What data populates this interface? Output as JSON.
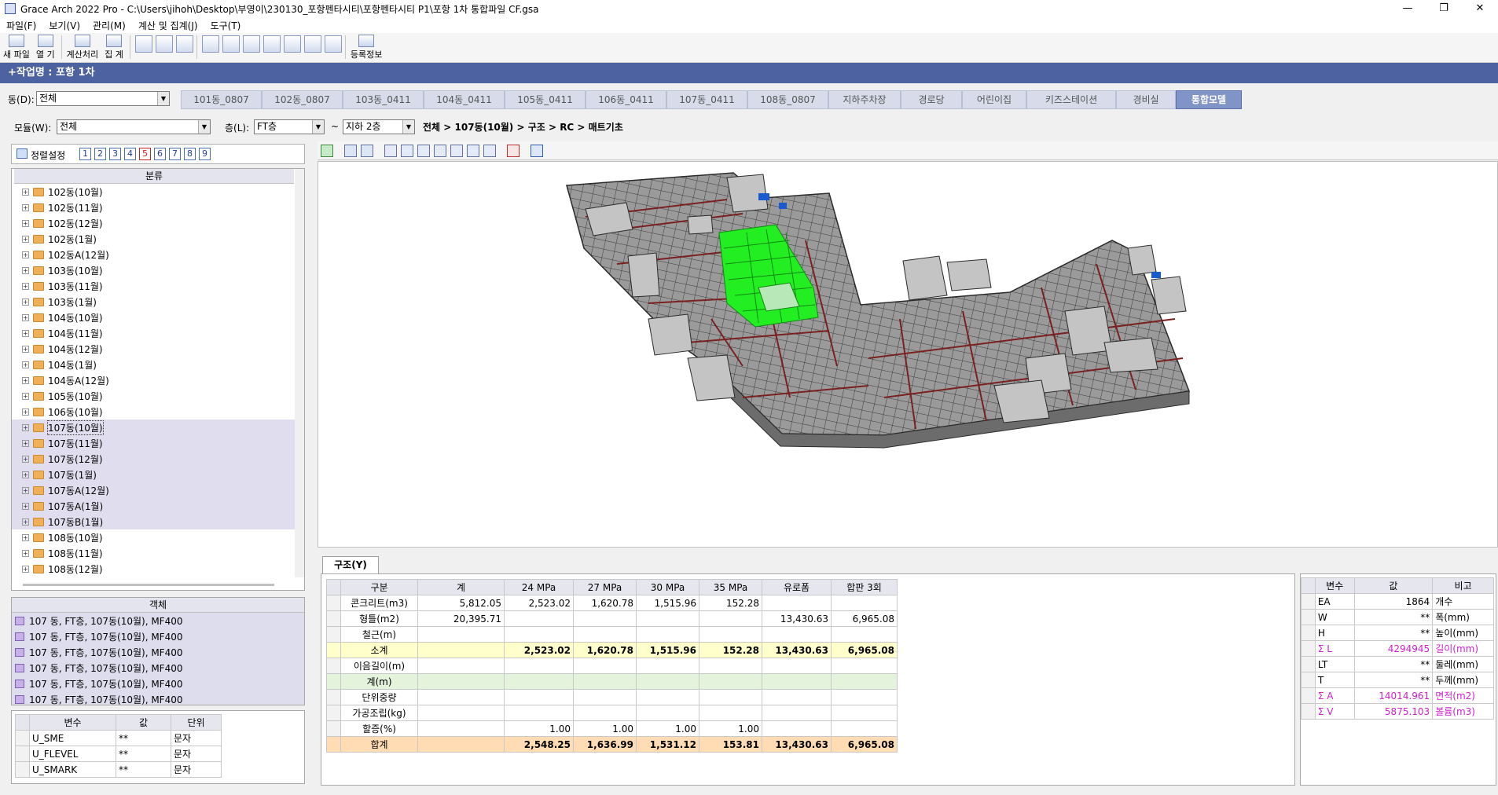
{
  "window": {
    "title": "Grace Arch 2022 Pro - C:\\Users\\jihoh\\Desktop\\부영이\\230130_포항펜타시티\\포항펜타시티 P1\\포항 1차 통합파일 CF.gsa",
    "controls": [
      "—",
      "❐",
      "✕"
    ]
  },
  "menu": [
    "파일(F)",
    "보기(V)",
    "관리(M)",
    "계산 및 집계(J)",
    "도구(T)"
  ],
  "toolbar": {
    "new": "새 파일",
    "open": "열   기",
    "calc": "계산처리",
    "sum": "집   계",
    "register": "등록정보"
  },
  "workbar": "+작업명 : 포항 1차",
  "dong": {
    "label": "동(D):",
    "value": "전체"
  },
  "tabs": [
    "101동_0807",
    "102동_0807",
    "103동_0411",
    "104동_0411",
    "105동_0411",
    "106동_0411",
    "107동_0411",
    "108동_0807",
    "지하주차장",
    "경로당",
    "어린이집",
    "키즈스테이션",
    "경비실",
    "통합모델"
  ],
  "module": {
    "label": "모듈(W):",
    "value": "전체"
  },
  "floor": {
    "label": "층(L):",
    "from": "FT층",
    "tilde": "~",
    "to": "지하 2층"
  },
  "breadcrumb": "전체 > 107동(10월) > 구조 > RC > 매트기초",
  "sort": {
    "label": "정렬설정",
    "nums": [
      "1",
      "2",
      "3",
      "4",
      "5",
      "6",
      "7",
      "8",
      "9"
    ],
    "active": "5"
  },
  "tree": {
    "header": "분류",
    "items": [
      "102동(10월)",
      "102동(11월)",
      "102동(12월)",
      "102동(1월)",
      "102동A(12월)",
      "103동(10월)",
      "103동(11월)",
      "103동(1월)",
      "104동(10월)",
      "104동(11월)",
      "104동(12월)",
      "104동(1월)",
      "104동A(12월)",
      "105동(10월)",
      "106동(10월)",
      "107동(10월)",
      "107동(11월)",
      "107동(12월)",
      "107동(1월)",
      "107동A(12월)",
      "107동A(1월)",
      "107동B(1월)",
      "108동(10월)",
      "108동(11월)",
      "108동(12월)"
    ]
  },
  "objects": {
    "header": "객체",
    "rows": [
      "107 동, FT층, 107동(10월), MF400",
      "107 동, FT층, 107동(10월), MF400",
      "107 동, FT층, 107동(10월), MF400",
      "107 동, FT층, 107동(10월), MF400",
      "107 동, FT층, 107동(10월), MF400",
      "107 동, FT층, 107동(10월), MF400"
    ]
  },
  "vars": {
    "headers": [
      "변수",
      "값",
      "단위"
    ],
    "rows": [
      [
        "U_SME",
        "**",
        "문자"
      ],
      [
        "U_FLEVEL",
        "**",
        "문자"
      ],
      [
        "U_SMARK",
        "**",
        "문자"
      ]
    ]
  },
  "result_tab": "구조(Y)",
  "result": {
    "headers": [
      "구분",
      "계",
      "24 MPa",
      "27 MPa",
      "30 MPa",
      "35 MPa",
      "유로폼",
      "합판 3회"
    ],
    "rows": [
      {
        "k": "normal",
        "cells": [
          "콘크리트(m3)",
          "5,812.05",
          "2,523.02",
          "1,620.78",
          "1,515.96",
          "152.28",
          "",
          ""
        ]
      },
      {
        "k": "normal",
        "cells": [
          "형틀(m2)",
          "20,395.71",
          "",
          "",
          "",
          "",
          "13,430.63",
          "6,965.08"
        ]
      },
      {
        "k": "normal",
        "cells": [
          "철근(m)",
          "",
          "",
          "",
          "",
          "",
          "",
          ""
        ]
      },
      {
        "k": "yellow",
        "cells": [
          "소계",
          "",
          "2,523.02",
          "1,620.78",
          "1,515.96",
          "152.28",
          "13,430.63",
          "6,965.08"
        ]
      },
      {
        "k": "normal",
        "cells": [
          "이음길이(m)",
          "",
          "",
          "",
          "",
          "",
          "",
          ""
        ]
      },
      {
        "k": "green",
        "cells": [
          "계(m)",
          "",
          "",
          "",
          "",
          "",
          "",
          ""
        ]
      },
      {
        "k": "normal",
        "cells": [
          "단위중량",
          "",
          "",
          "",
          "",
          "",
          "",
          ""
        ]
      },
      {
        "k": "normal",
        "cells": [
          "가공조립(kg)",
          "",
          "",
          "",
          "",
          "",
          "",
          ""
        ]
      },
      {
        "k": "normal",
        "cells": [
          "할증(%)",
          "",
          "1.00",
          "1.00",
          "1.00",
          "1.00",
          "",
          ""
        ]
      },
      {
        "k": "orange",
        "cells": [
          "합계",
          "",
          "2,548.25",
          "1,636.99",
          "1,531.12",
          "153.81",
          "13,430.63",
          "6,965.08"
        ]
      }
    ]
  },
  "props": {
    "headers": [
      "변수",
      "값",
      "비고"
    ],
    "rows": [
      {
        "n": "EA",
        "v": "1864",
        "u": "개수",
        "m": false
      },
      {
        "n": "W",
        "v": "**",
        "u": "폭(mm)",
        "m": false
      },
      {
        "n": "H",
        "v": "**",
        "u": "높이(mm)",
        "m": false
      },
      {
        "n": "Σ L",
        "v": "4294945",
        "u": "길이(mm)",
        "m": true
      },
      {
        "n": "LT",
        "v": "**",
        "u": "둘레(mm)",
        "m": false
      },
      {
        "n": "T",
        "v": "**",
        "u": "두께(mm)",
        "m": false
      },
      {
        "n": "Σ A",
        "v": "14014.961",
        "u": "면적(m2)",
        "m": true
      },
      {
        "n": "Σ V",
        "v": "5875.103",
        "u": "볼륨(m3)",
        "m": true
      }
    ]
  },
  "colors": {
    "accent": "#4d62a0",
    "tab_active": "#8094c8",
    "model_gray": "#8c8c8c",
    "highlight_green": "#22ee22",
    "beam_red": "#8a2a2a"
  }
}
